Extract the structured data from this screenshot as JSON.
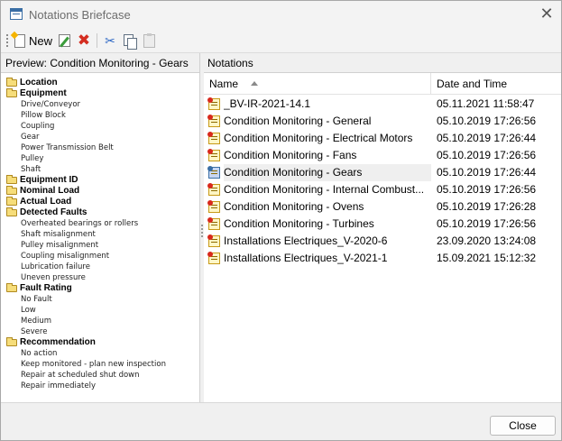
{
  "window": {
    "title": "Notations Briefcase",
    "close_glyph": "✕"
  },
  "toolbar": {
    "new_label": "New",
    "icons": [
      "new-icon",
      "edit-icon",
      "delete-icon",
      "cut-icon",
      "copy-icon",
      "paste-icon"
    ]
  },
  "preview": {
    "header": "Preview: Condition Monitoring - Gears",
    "rows": [
      {
        "type": "category",
        "text": "Location"
      },
      {
        "type": "category",
        "text": "Equipment"
      },
      {
        "type": "item",
        "text": "Drive/Conveyor"
      },
      {
        "type": "item",
        "text": "Pillow Block"
      },
      {
        "type": "item",
        "text": "Coupling"
      },
      {
        "type": "item",
        "text": "Gear"
      },
      {
        "type": "item",
        "text": "Power Transmission Belt"
      },
      {
        "type": "item",
        "text": "Pulley"
      },
      {
        "type": "item",
        "text": "Shaft"
      },
      {
        "type": "category",
        "text": "Equipment ID"
      },
      {
        "type": "category",
        "text": "Nominal Load"
      },
      {
        "type": "category",
        "text": "Actual Load"
      },
      {
        "type": "category",
        "text": "Detected Faults"
      },
      {
        "type": "item",
        "text": "Overheated bearings or rollers"
      },
      {
        "type": "item",
        "text": "Shaft misalignment"
      },
      {
        "type": "item",
        "text": "Pulley misalignment"
      },
      {
        "type": "item",
        "text": "Coupling misalignment"
      },
      {
        "type": "item",
        "text": "Lubrication failure"
      },
      {
        "type": "item",
        "text": "Uneven pressure"
      },
      {
        "type": "category",
        "text": "Fault Rating"
      },
      {
        "type": "item",
        "text": "No Fault"
      },
      {
        "type": "item",
        "text": "Low"
      },
      {
        "type": "item",
        "text": "Medium"
      },
      {
        "type": "item",
        "text": "Severe"
      },
      {
        "type": "category",
        "text": "Recommendation"
      },
      {
        "type": "item",
        "text": "No action"
      },
      {
        "type": "item",
        "text": "Keep monitored - plan new inspection"
      },
      {
        "type": "item",
        "text": "Repair at scheduled shut down"
      },
      {
        "type": "item",
        "text": "Repair immediately"
      }
    ]
  },
  "notations": {
    "header": "Notations",
    "columns": {
      "name": "Name",
      "date": "Date and Time"
    },
    "sort_column": "name",
    "sort_direction": "ascending",
    "rows": [
      {
        "name": "_BV-IR-2021-14.1",
        "date": "05.11.2021 11:58:47",
        "selected": false
      },
      {
        "name": "Condition Monitoring -  General",
        "date": "05.10.2019 17:26:56",
        "selected": false
      },
      {
        "name": "Condition Monitoring - Electrical Motors",
        "date": "05.10.2019 17:26:44",
        "selected": false
      },
      {
        "name": "Condition Monitoring - Fans",
        "date": "05.10.2019 17:26:56",
        "selected": false
      },
      {
        "name": "Condition Monitoring - Gears",
        "date": "05.10.2019 17:26:44",
        "selected": true
      },
      {
        "name": "Condition Monitoring - Internal Combust...",
        "date": "05.10.2019 17:26:56",
        "selected": false
      },
      {
        "name": "Condition Monitoring - Ovens",
        "date": "05.10.2019 17:26:28",
        "selected": false
      },
      {
        "name": "Condition Monitoring - Turbines",
        "date": "05.10.2019 17:26:56",
        "selected": false
      },
      {
        "name": "Installations Electriques_V-2020-6",
        "date": "23.09.2020 13:24:08",
        "selected": false
      },
      {
        "name": "Installations Electriques_V-2021-1",
        "date": "15.09.2021 15:12:32",
        "selected": false
      }
    ]
  },
  "footer": {
    "close_label": "Close"
  }
}
